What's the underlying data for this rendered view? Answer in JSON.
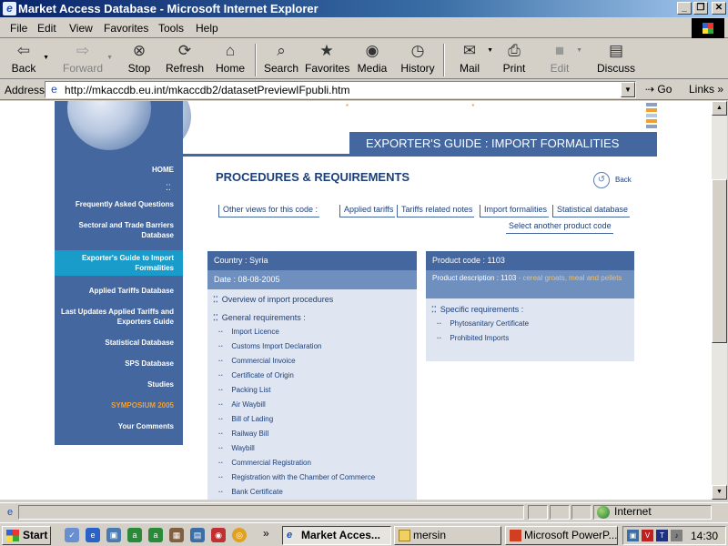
{
  "window": {
    "title": "Market Access Database - Microsoft Internet Explorer",
    "min_label": "_",
    "max_label": "❐",
    "close_label": "✕"
  },
  "menu": [
    "File",
    "Edit",
    "View",
    "Favorites",
    "Tools",
    "Help"
  ],
  "toolbar": {
    "back": "Back",
    "forward": "Forward",
    "stop": "Stop",
    "refresh": "Refresh",
    "home": "Home",
    "search": "Search",
    "favorites": "Favorites",
    "media": "Media",
    "history": "History",
    "mail": "Mail",
    "print": "Print",
    "edit": "Edit",
    "discuss": "Discuss"
  },
  "address": {
    "label": "Address",
    "url": "http://mkaccdb.eu.int/mkaccdb2/datasetPreviewIFpubli.htm",
    "go": "Go",
    "links": "Links"
  },
  "sidebar": {
    "items": [
      "HOME",
      "Frequently Asked Questions",
      "Sectoral and Trade Barriers Database",
      "Exporter's Guide to Import Formalities",
      "Applied Tariffs Database",
      "Last Updates Applied Tariffs and Exporters Guide",
      "Statistical Database",
      "SPS Database",
      "Studies",
      "SYMPOSIUM 2005",
      "Your Comments"
    ]
  },
  "banner": "EXPORTER'S GUIDE : IMPORT FORMALITIES",
  "heading": "PROCEDURES & REQUIREMENTS",
  "back_label": "Back",
  "views": {
    "prefix": "Other views for this code :",
    "links": [
      "Applied tariffs",
      "Tariffs related notes",
      "Import formalities",
      "Statistical database"
    ],
    "select_code": "Select another product code"
  },
  "left_panel": {
    "country": "Country : Syria",
    "date": "Date : 08-08-2005",
    "overview": "Overview of import procedures",
    "general_title": "General requirements :",
    "general_items": [
      "Import Licence",
      "Customs Import Declaration",
      "Commercial Invoice",
      "Certificate of Origin",
      "Packing List",
      "Air Waybill",
      "Bill of Lading",
      "Railway Bill",
      "Waybill",
      "Commercial Registration",
      "Registration with the Chamber of Commerce",
      "Bank Certificate"
    ]
  },
  "right_panel": {
    "product_code": "Product code : 1103",
    "description_label": "Product description : 1103",
    "description_text": " - cereal groats, meal and pellets",
    "specific_title": "Specific requirements :",
    "specific_items": [
      "Phytosanitary Certificate",
      "Prohibited Imports"
    ]
  },
  "status": {
    "zone": "Internet"
  },
  "taskbar": {
    "start": "Start",
    "more": "»",
    "tasks": [
      "Market Acces...",
      "mersin",
      "Microsoft PowerP..."
    ],
    "clock": "14:30"
  },
  "colors": {
    "nav_blue": "#44679f",
    "active_cyan": "#1a9ccb",
    "heading_navy": "#1d3f7a",
    "symposium_orange": "#f0a030"
  }
}
